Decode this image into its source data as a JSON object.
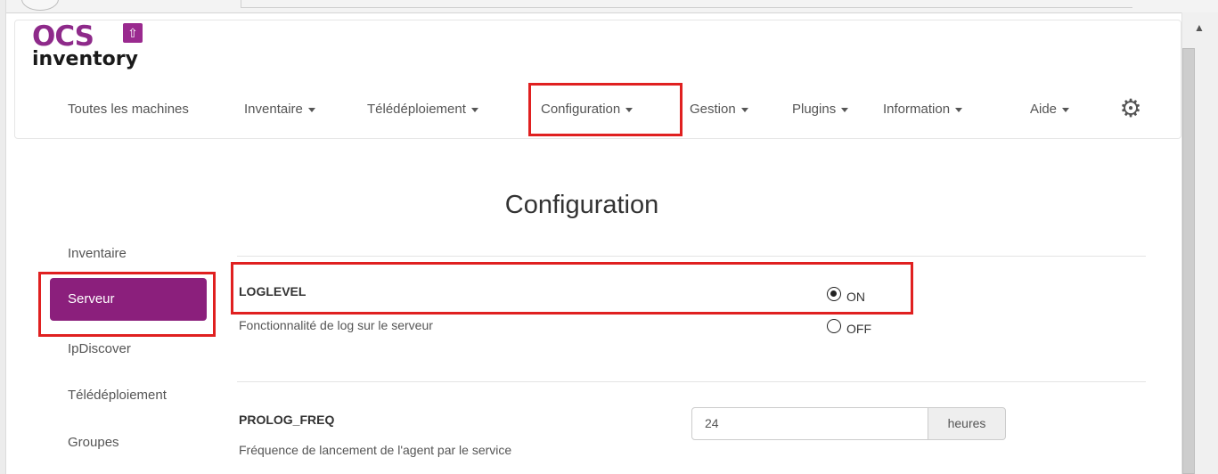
{
  "logo": {
    "brand": "OCS",
    "product": "inventory"
  },
  "nav": {
    "items": [
      {
        "label": "Toutes les machines",
        "dropdown": false
      },
      {
        "label": "Inventaire",
        "dropdown": true
      },
      {
        "label": "Télédéploiement",
        "dropdown": true
      },
      {
        "label": "Configuration",
        "dropdown": true
      },
      {
        "label": "Gestion",
        "dropdown": true
      },
      {
        "label": "Plugins",
        "dropdown": true
      },
      {
        "label": "Information",
        "dropdown": true
      },
      {
        "label": "Aide",
        "dropdown": true
      }
    ],
    "settings_icon": "gear-icon"
  },
  "page": {
    "title": "Configuration"
  },
  "sidebar": {
    "items": [
      {
        "label": "Inventaire"
      },
      {
        "label": "Serveur",
        "active": true
      },
      {
        "label": "IpDiscover"
      },
      {
        "label": "Télédéploiement"
      },
      {
        "label": "Groupes"
      }
    ]
  },
  "options": {
    "loglevel": {
      "name": "LOGLEVEL",
      "description": "Fonctionnalité de log sur le serveur",
      "on_label": "ON",
      "off_label": "OFF",
      "selected": "ON"
    },
    "prolog_freq": {
      "name": "PROLOG_FREQ",
      "description": "Fréquence de lancement de l'agent par le service",
      "value": "24",
      "unit": "heures"
    }
  },
  "colors": {
    "accent": "#8b1f7c",
    "highlight": "#e02020"
  }
}
